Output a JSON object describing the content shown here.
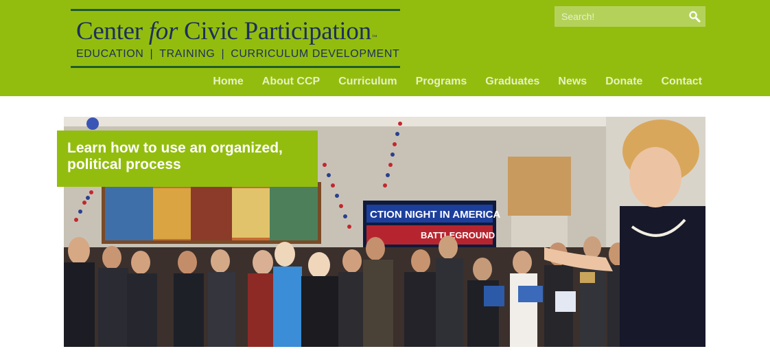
{
  "site": {
    "logo": {
      "title_before": "Center ",
      "title_italic": "for",
      "title_after": " Civic Participation",
      "trademark": "™",
      "tagline_parts": [
        "EDUCATION",
        "TRAINING",
        "CURRICULUM DEVELOPMENT"
      ],
      "separator": "|"
    },
    "search": {
      "placeholder": "Search!",
      "icon": "magnifier-icon"
    },
    "nav": [
      {
        "label": "Home"
      },
      {
        "label": "About CCP"
      },
      {
        "label": "Curriculum"
      },
      {
        "label": "Programs"
      },
      {
        "label": "Graduates"
      },
      {
        "label": "News"
      },
      {
        "label": "Donate"
      },
      {
        "label": "Contact"
      }
    ]
  },
  "hero": {
    "caption": "Learn how to use an organized, political process",
    "screen_text_line1": "CTION NIGHT IN AMERICA",
    "screen_text_line2": "BATTLEGROUND"
  },
  "colors": {
    "brand_green": "#93bd0e",
    "logo_navy": "#1b2f5e",
    "logo_rule": "#1f5a2c",
    "nav_text": "#e6f2bf"
  }
}
